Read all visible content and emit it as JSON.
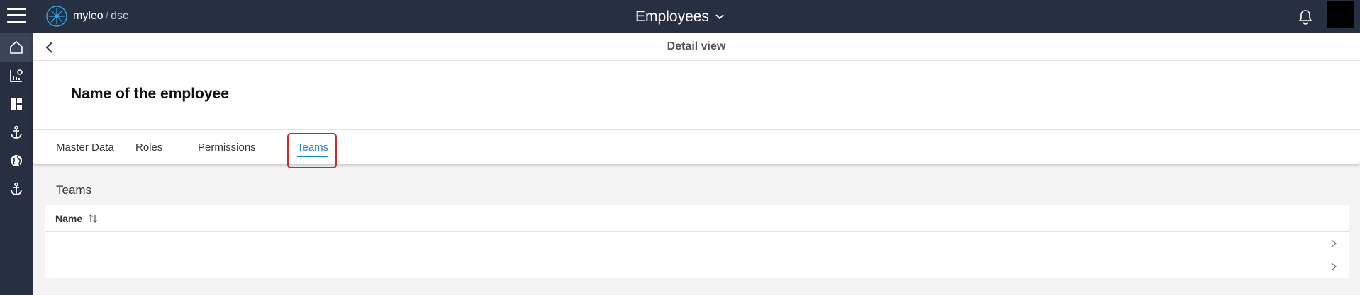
{
  "topbar": {
    "logo_name": "myleo",
    "logo_slash": "/",
    "logo_sub": "dsc",
    "app_title": "Employees",
    "icons": [
      "hamburger-icon",
      "logo-icon",
      "chevron-down-icon",
      "bell-icon"
    ]
  },
  "sidebar": {
    "items": [
      {
        "icon": "home-icon"
      },
      {
        "icon": "chart-icon"
      },
      {
        "icon": "dashboard-icon"
      },
      {
        "icon": "anchor-icon"
      },
      {
        "icon": "globe-icon"
      },
      {
        "icon": "anchor-icon"
      }
    ]
  },
  "detail": {
    "title": "Detail view",
    "employee_name": "Name of the employee"
  },
  "tabs": [
    {
      "label": "Master Data"
    },
    {
      "label": "Roles"
    },
    {
      "label": "Permissions"
    },
    {
      "label": "Teams",
      "active": true
    }
  ],
  "teams": {
    "section_title": "Teams",
    "column_name": "Name",
    "rows": [
      "",
      ""
    ]
  },
  "colors": {
    "topbar": "#263040",
    "accent": "#1a86d8",
    "highlight": "#d6262a"
  }
}
